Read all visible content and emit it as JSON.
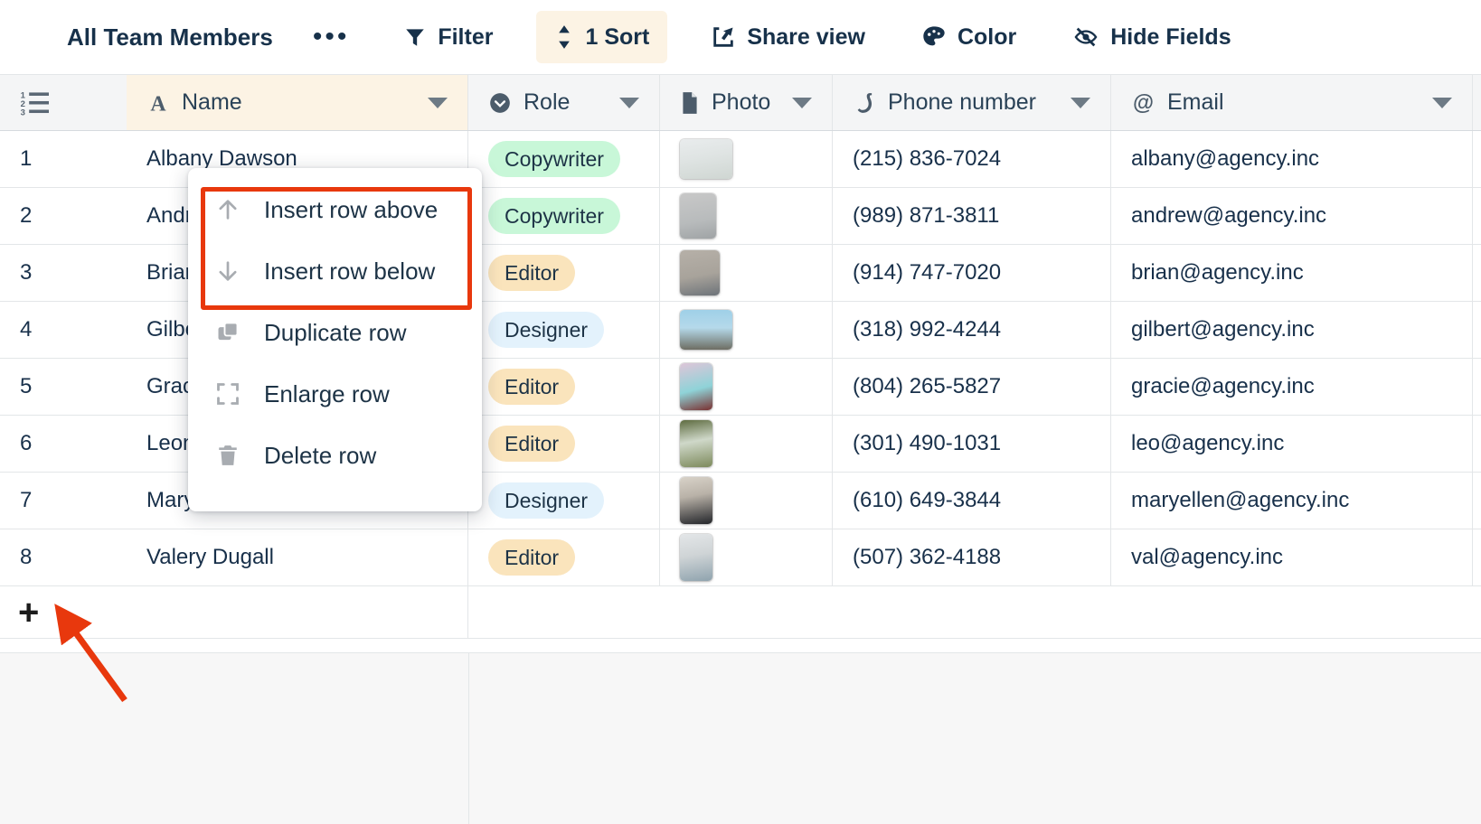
{
  "toolbar": {
    "view_name": "All Team Members",
    "more_options": "•••",
    "items": [
      {
        "label": "Filter",
        "icon": "filter-icon"
      },
      {
        "label": "1 Sort",
        "icon": "sort-icon",
        "active": true
      },
      {
        "label": "Share view",
        "icon": "share-icon"
      },
      {
        "label": "Color",
        "icon": "palette-icon"
      },
      {
        "label": "Hide Fields",
        "icon": "eye-off-icon"
      }
    ]
  },
  "grid": {
    "row_number_header_icon": "numbered-list-icon",
    "columns": [
      {
        "label": "Name",
        "icon": "text-field-icon",
        "sorted": true
      },
      {
        "label": "Role",
        "icon": "single-select-icon",
        "sorted": false
      },
      {
        "label": "Photo",
        "icon": "attachment-icon",
        "sorted": false
      },
      {
        "label": "Phone number",
        "icon": "phone-icon",
        "sorted": false
      },
      {
        "label": "Email",
        "icon": "email-icon",
        "sorted": false
      }
    ],
    "rows": [
      {
        "num": "1",
        "name": "Albany Dawson",
        "role": "Copywriter",
        "role_color": "green",
        "phone": "(215) 836-7024",
        "email": "albany@agency.inc"
      },
      {
        "num": "2",
        "name": "Andrew Ngyuen",
        "role": "Copywriter",
        "role_color": "green",
        "phone": "(989) 871-3811",
        "email": "andrew@agency.inc"
      },
      {
        "num": "3",
        "name": "Brian Sprouse",
        "role": "Editor",
        "role_color": "tan",
        "phone": "(914) 747-7020",
        "email": "brian@agency.inc"
      },
      {
        "num": "4",
        "name": "Gilbert Marshall",
        "role": "Designer",
        "role_color": "blue",
        "phone": "(318) 992-4244",
        "email": "gilbert@agency.inc"
      },
      {
        "num": "5",
        "name": "Gracie Jones",
        "role": "Editor",
        "role_color": "tan",
        "phone": "(804) 265-5827",
        "email": "gracie@agency.inc"
      },
      {
        "num": "6",
        "name": "Leonardo Esposito",
        "role": "Editor",
        "role_color": "tan",
        "phone": "(301) 490-1031",
        "email": "leo@agency.inc"
      },
      {
        "num": "7",
        "name": "Mary Ellen Waasgard",
        "role": "Designer",
        "role_color": "blue",
        "phone": "(610) 649-3844",
        "email": "maryellen@agency.inc"
      },
      {
        "num": "8",
        "name": "Valery Dugall",
        "role": "Editor",
        "role_color": "tan",
        "phone": "(507) 362-4188",
        "email": "val@agency.inc"
      }
    ],
    "add_row_label": "+"
  },
  "context_menu": {
    "items": [
      {
        "label": "Insert row above",
        "icon": "arrow-up-icon",
        "highlighted": true
      },
      {
        "label": "Insert row below",
        "icon": "arrow-down-icon",
        "highlighted": true
      },
      {
        "label": "Duplicate row",
        "icon": "duplicate-icon",
        "highlighted": false
      },
      {
        "label": "Enlarge row",
        "icon": "expand-icon",
        "highlighted": false
      },
      {
        "label": "Delete row",
        "icon": "trash-icon",
        "highlighted": false
      }
    ]
  },
  "annotations": {
    "highlight_color": "#e8380d",
    "arrow_color": "#e8380d",
    "arrow_target": "add-row-button"
  },
  "colors": {
    "sorted_header_bg": "#fcf3e4",
    "header_bg": "#f4f5f6",
    "text": "#18304a",
    "badge_green": "#c8f7d8",
    "badge_tan": "#fae4bc",
    "badge_blue": "#e3f2fc",
    "hamburger_blue": "#4a8fd4"
  }
}
